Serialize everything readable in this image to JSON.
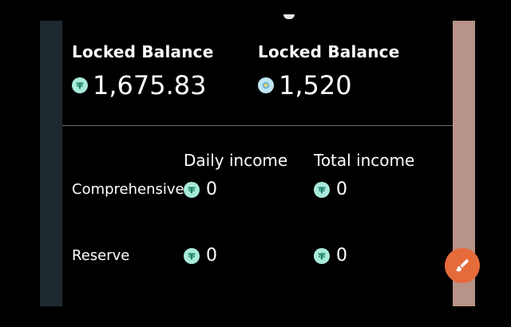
{
  "balances": {
    "left": {
      "label": "Locked Balance",
      "value": "1,675.83",
      "icon": "tether-icon"
    },
    "right": {
      "label": "Locked Balance",
      "value": "1,520",
      "icon": "coin-icon"
    }
  },
  "income": {
    "headers": {
      "daily": "Daily income",
      "total": "Total income"
    },
    "rows": [
      {
        "label": "Comprehensive",
        "daily": "0",
        "total": "0"
      },
      {
        "label": "Reserve",
        "daily": "0",
        "total": "0"
      }
    ]
  },
  "colors": {
    "background": "#000000",
    "coin": "#a8ead9",
    "fab": "#e56b3b"
  }
}
